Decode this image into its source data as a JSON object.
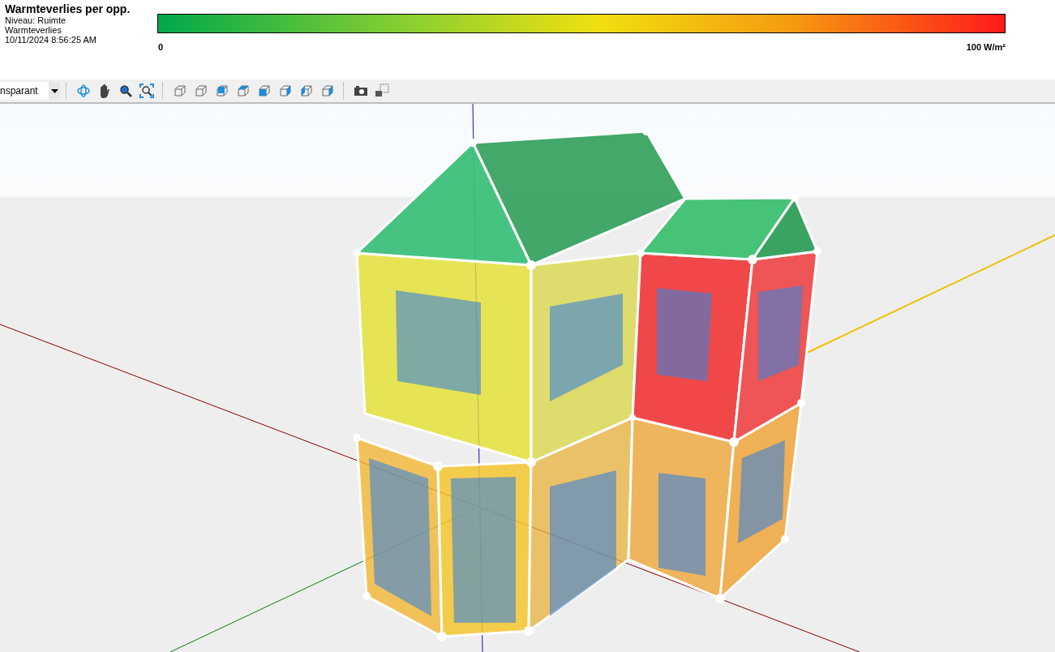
{
  "legend": {
    "title": "Warmteverlies per opp.",
    "details": [
      "Niveau:  Ruimte",
      "Warmteverlies",
      "10/11/2024 8:56:25 AM"
    ],
    "scale_min": "0",
    "scale_max": "100 W/m²"
  },
  "toolbar": {
    "view_mode": "nsparant"
  }
}
